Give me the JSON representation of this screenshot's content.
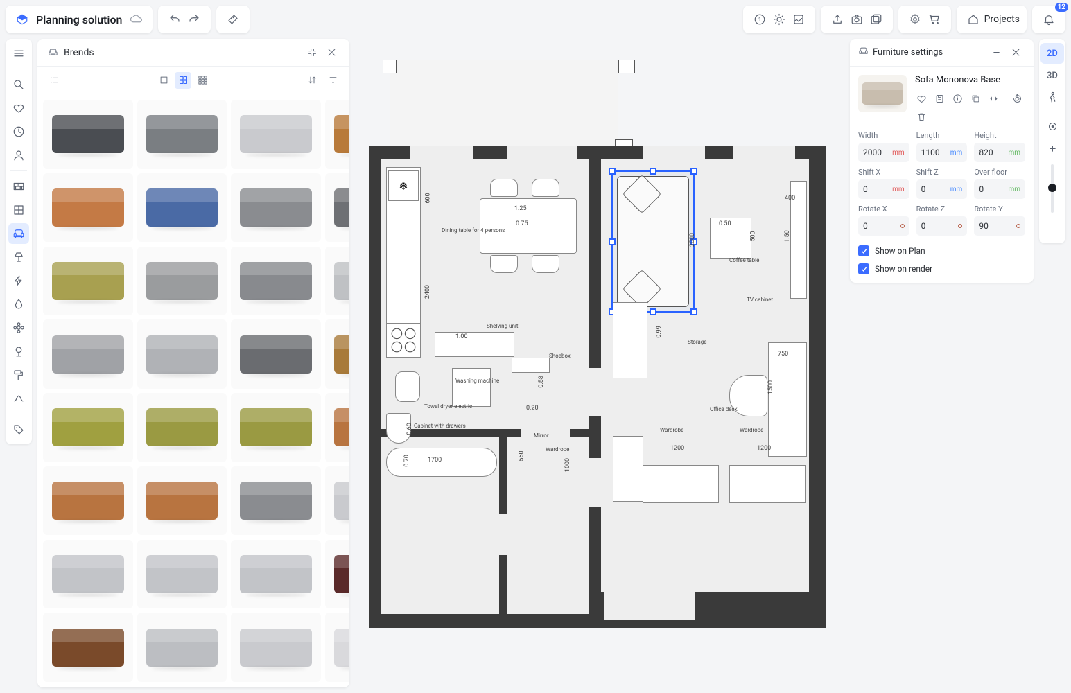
{
  "header": {
    "title": "Planning solution",
    "projects_label": "Projects",
    "notification_count": "12"
  },
  "left_rail": {
    "items": [
      {
        "name": "menu",
        "icon": "menu"
      },
      {
        "name": "search",
        "icon": "search"
      },
      {
        "name": "favorites",
        "icon": "heart"
      },
      {
        "name": "history",
        "icon": "clock"
      },
      {
        "name": "user",
        "icon": "user"
      },
      {
        "name": "walls",
        "icon": "brick"
      },
      {
        "name": "rooms",
        "icon": "grid"
      },
      {
        "name": "furniture",
        "icon": "sofa",
        "active": true
      },
      {
        "name": "lighting",
        "icon": "lamp"
      },
      {
        "name": "electrical",
        "icon": "bolt"
      },
      {
        "name": "plumbing",
        "icon": "drop"
      },
      {
        "name": "decoration",
        "icon": "flower"
      },
      {
        "name": "plants",
        "icon": "tree"
      },
      {
        "name": "tools",
        "icon": "roller"
      },
      {
        "name": "paths",
        "icon": "path"
      },
      {
        "name": "tags",
        "icon": "tag"
      }
    ]
  },
  "catalog": {
    "title": "Brends",
    "colors": [
      "#4a4d52",
      "#7a7e82",
      "#c9cace",
      "#b87a3a",
      "#c47a45",
      "#4a6aa5",
      "#8a8c90",
      "#6e7074",
      "#a8a050",
      "#9a9c9e",
      "#888a8e",
      "#bfc1c4",
      "#a0a2a6",
      "#b0b2b6",
      "#6a6c70",
      "#a87a3a",
      "#a0a040",
      "#9a9a42",
      "#9a9a42",
      "#b87440",
      "#b87440",
      "#b87440",
      "#8a8c90",
      "#c9cace",
      "#c2c4c8",
      "#c2c4c8",
      "#c2c4c8",
      "#5a2a2a",
      "#7a4a2a",
      "#bcbec2",
      "#c9cace",
      "#d9d9dc"
    ]
  },
  "right_rail": {
    "view2d": "2D",
    "view3d": "3D"
  },
  "settings": {
    "title": "Furniture settings",
    "item_name": "Sofa Mononova Base",
    "props": [
      {
        "label": "Width",
        "value": "2000",
        "unit": "mm",
        "ucls": "unit-mm-r"
      },
      {
        "label": "Length",
        "value": "1100",
        "unit": "mm",
        "ucls": "unit-mm-b"
      },
      {
        "label": "Height",
        "value": "820",
        "unit": "mm",
        "ucls": "unit-mm-g"
      },
      {
        "label": "Shift X",
        "value": "0",
        "unit": "mm",
        "ucls": "unit-mm-r"
      },
      {
        "label": "Shift Z",
        "value": "0",
        "unit": "mm",
        "ucls": "unit-mm-b"
      },
      {
        "label": "Over floor",
        "value": "0",
        "unit": "mm",
        "ucls": "unit-mm-g"
      },
      {
        "label": "Rotate X",
        "value": "0",
        "unit": "deg",
        "ucls": "unit-deg"
      },
      {
        "label": "Rotate Z",
        "value": "0",
        "unit": "deg",
        "ucls": "unit-deg"
      },
      {
        "label": "Rotate Y",
        "value": "90",
        "unit": "deg",
        "ucls": "unit-deg"
      }
    ],
    "check1": "Show on Plan",
    "check2": "Show on render"
  },
  "plan": {
    "labels": {
      "dining": "Dining table\nfor 4 persons",
      "shelving": "Shelving unit",
      "coffee": "Coffee table",
      "tv": "TV cabinet",
      "storage": "Storage",
      "office": "Office desk",
      "wardrobe": "Wardrobe",
      "wardrobe2": "Wardrobe",
      "shoebox": "Shoebox",
      "mirror": "Mirror",
      "washing": "Washing\nmachine",
      "towel": "Towel dryer electric",
      "cabinet": "Cabinet with drawers"
    },
    "dims": {
      "d600": "600",
      "d2400": "2400",
      "d125": "1.25",
      "d075": "0.75",
      "d050": "0.50",
      "d500": "500",
      "d2000": "2000",
      "d400": "400",
      "d150": "1.50",
      "d100": "1.00",
      "d099": "0.99",
      "d058": "0.58",
      "d020": "0.20",
      "d060": "0.60",
      "d1700": "1700",
      "d070": "0.70",
      "d650": "550",
      "d1000": "1000",
      "d750": "750",
      "d1500": "1500",
      "d1200": "1200",
      "d1200b": "1200"
    }
  }
}
